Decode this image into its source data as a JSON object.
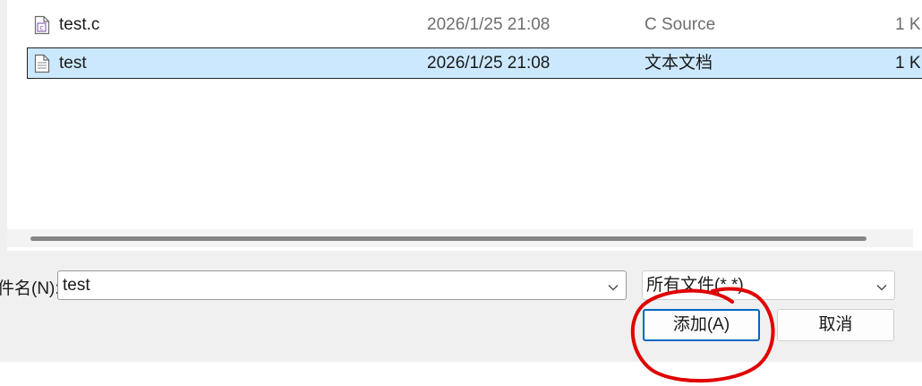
{
  "files": [
    {
      "name": "test.c",
      "date": "2026/1/25 21:08",
      "type": "C Source",
      "size": "1 K",
      "icon": "c-source-file-icon",
      "selected": false
    },
    {
      "name": "test",
      "date": "2026/1/25 21:08",
      "type": "文本文档",
      "size": "1 K",
      "icon": "text-file-icon",
      "selected": true
    }
  ],
  "filename": {
    "label": "件名(N):",
    "value": "test"
  },
  "filetype": {
    "value": "所有文件(*.*)"
  },
  "buttons": {
    "add_label": "添加(A)",
    "cancel_label": "取消"
  },
  "colors": {
    "selection": "#cce8ff",
    "accent": "#0067c0",
    "annotation": "#e00000"
  }
}
